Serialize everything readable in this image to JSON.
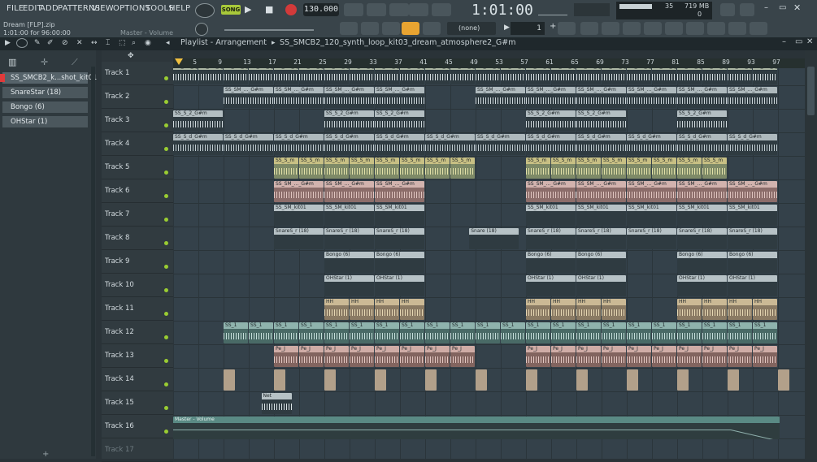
{
  "menu": [
    "FILE",
    "EDIT",
    "ADD",
    "PATTERNS",
    "VIEW",
    "OPTIONS",
    "TOOLS",
    "HELP"
  ],
  "hint": {
    "project": "Dream [FLP].zip",
    "position": "1:01:00 for 96:00:00",
    "target": "Master - Volume"
  },
  "transport": {
    "mode": "SONG",
    "tempo": "130.000",
    "time": "1:01:00",
    "cpu": "35",
    "mem": "719 MB",
    "voices": "0"
  },
  "toolbar2": {
    "pattern_select": "(none)",
    "snap_value": "1"
  },
  "playlist": {
    "title": "Playlist - Arrangement",
    "pattern": "SS_SMCB2_120_synth_loop_kit03_dream_atmosphere2_G#m"
  },
  "patterns": [
    "SS_SMCB2_k...shot_kit01",
    "SnareStar  (18)",
    "Bongo  (6)",
    "OHStar (1)"
  ],
  "ruler": [
    "5",
    "9",
    "13",
    "17",
    "21",
    "25",
    "29",
    "33",
    "37",
    "41",
    "45",
    "49",
    "53",
    "57",
    "61",
    "65",
    "69",
    "73",
    "77",
    "81",
    "85",
    "89",
    "93",
    "97"
  ],
  "tracks": [
    "Track 1",
    "Track 2",
    "Track 3",
    "Track 4",
    "Track 5",
    "Track 6",
    "Track 7",
    "Track 8",
    "Track 9",
    "Track 10",
    "Track 11",
    "Track 12",
    "Track 13",
    "Track 14",
    "Track 15",
    "Track 16",
    "Track 17"
  ],
  "clip_labels": {
    "t1": "SS_SM_s_G#m",
    "t2": "SS_SM_..._G#m",
    "t3": "SS_S_2_G#m",
    "t4": "SS_S_d_G#m",
    "t5": "SS_S_m",
    "t6": "SS_SM_..._G#m",
    "t7": "SS_SM_kit01",
    "t8": "SnareS_r (18)",
    "t8b": "Snare  (18)",
    "t9": "Bongo (6)",
    "t10": "OHStar (1)",
    "t11": "HH",
    "t12": "SS_1",
    "t13": "Pe_J",
    "t15": "Net",
    "t16": "Master - Volume"
  }
}
